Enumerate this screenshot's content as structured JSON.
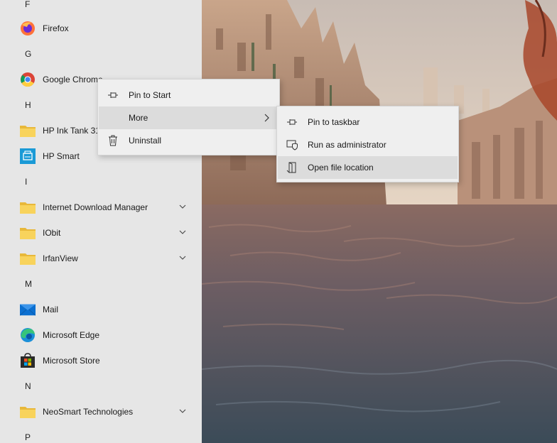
{
  "start_menu": {
    "rows": [
      {
        "type": "letter",
        "text": "F"
      },
      {
        "type": "app",
        "label": "Firefox",
        "icon": "firefox-icon"
      },
      {
        "type": "letter",
        "text": "G"
      },
      {
        "type": "app",
        "label": "Google Chrome",
        "icon": "chrome-icon"
      },
      {
        "type": "letter",
        "text": "H"
      },
      {
        "type": "folder",
        "label": "HP Ink Tank 31",
        "icon": "folder-icon"
      },
      {
        "type": "app",
        "label": "HP Smart",
        "icon": "hp-smart-icon"
      },
      {
        "type": "letter",
        "text": "I"
      },
      {
        "type": "folder",
        "label": "Internet Download Manager",
        "icon": "folder-icon",
        "expandable": true
      },
      {
        "type": "folder",
        "label": "IObit",
        "icon": "folder-icon",
        "expandable": true
      },
      {
        "type": "folder",
        "label": "IrfanView",
        "icon": "folder-icon",
        "expandable": true
      },
      {
        "type": "letter",
        "text": "M"
      },
      {
        "type": "app",
        "label": "Mail",
        "icon": "mail-icon"
      },
      {
        "type": "app",
        "label": "Microsoft Edge",
        "icon": "edge-icon"
      },
      {
        "type": "app",
        "label": "Microsoft Store",
        "icon": "store-icon"
      },
      {
        "type": "letter",
        "text": "N"
      },
      {
        "type": "folder",
        "label": "NeoSmart Technologies",
        "icon": "folder-icon",
        "expandable": true
      },
      {
        "type": "letter",
        "text": "P"
      }
    ]
  },
  "context_menu": {
    "items": [
      {
        "label": "Pin to Start",
        "icon": "pin-icon"
      },
      {
        "label": "More",
        "icon": "",
        "submenu": true
      },
      {
        "label": "Uninstall",
        "icon": "trash-icon"
      }
    ]
  },
  "more_submenu": {
    "items": [
      {
        "label": "Pin to taskbar",
        "icon": "pin-icon"
      },
      {
        "label": "Run as administrator",
        "icon": "shield-icon"
      },
      {
        "label": "Open file location",
        "icon": "file-location-icon"
      }
    ]
  },
  "colors": {
    "list_background": "#e6e6e6",
    "menu_background": "#efefef",
    "menu_hover": "#dcdcdc",
    "folder_yellow": "#f8d35c",
    "hp_blue": "#1a9ad6",
    "mail_blue": "#0b6fd0"
  }
}
